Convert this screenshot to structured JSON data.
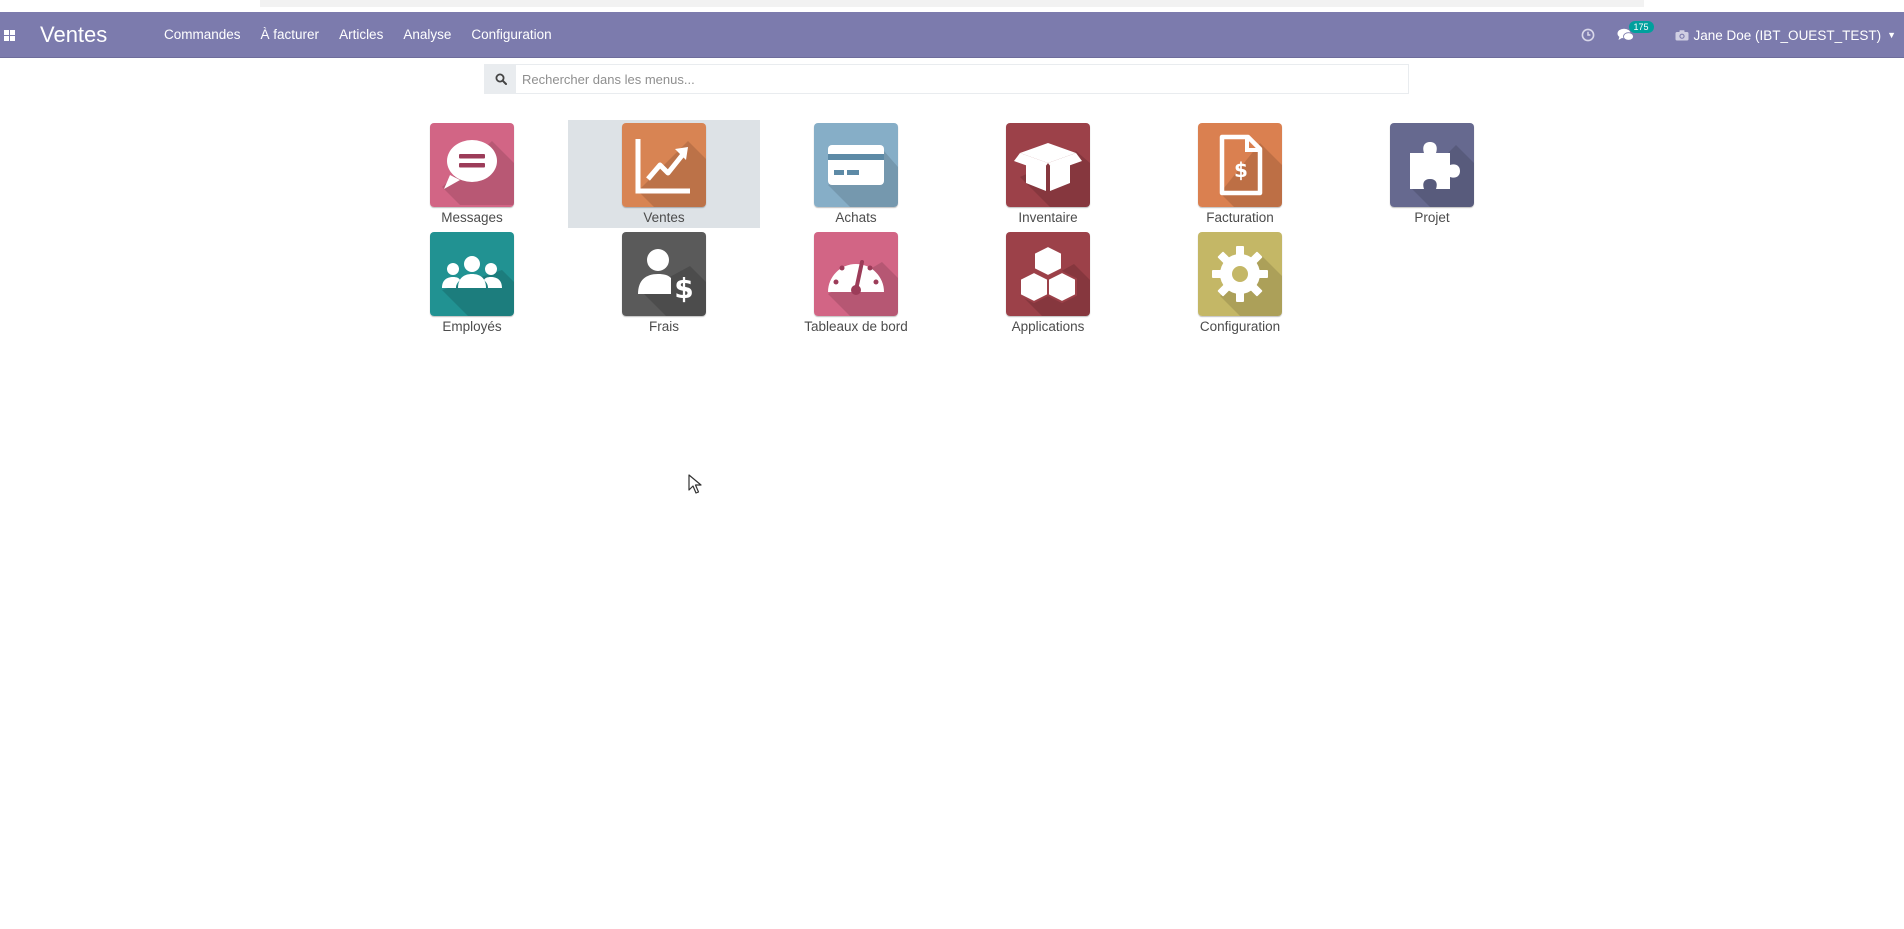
{
  "navbar": {
    "app_title": "Ventes",
    "menu_items": [
      "Commandes",
      "À facturer",
      "Articles",
      "Analyse",
      "Configuration"
    ],
    "chat_count": "175",
    "user_label": "Jane Doe (IBT_OUEST_TEST)",
    "bg_color": "#7c7bad"
  },
  "search": {
    "placeholder": "Rechercher dans les menus..."
  },
  "apps": [
    {
      "label": "Messages",
      "icon": "speech-bubble-icon",
      "color": "#d26585"
    },
    {
      "label": "Ventes",
      "icon": "trend-chart-icon",
      "color": "#d88453",
      "selected": true
    },
    {
      "label": "Achats",
      "icon": "credit-card-icon",
      "color": "#86aec7"
    },
    {
      "label": "Inventaire",
      "icon": "open-box-icon",
      "color": "#9c4149"
    },
    {
      "label": "Facturation",
      "icon": "invoice-dollar-icon",
      "color": "#da8050"
    },
    {
      "label": "Projet",
      "icon": "puzzle-icon",
      "color": "#66698f"
    },
    {
      "label": "Employés",
      "icon": "people-group-icon",
      "color": "#219292"
    },
    {
      "label": "Frais",
      "icon": "user-dollar-icon",
      "color": "#5a5a5a"
    },
    {
      "label": "Tableaux de bord",
      "icon": "speedometer-icon",
      "color": "#d26585"
    },
    {
      "label": "Applications",
      "icon": "cubes-icon",
      "color": "#9c4149"
    },
    {
      "label": "Configuration",
      "icon": "gear-icon",
      "color": "#c4b766"
    }
  ]
}
